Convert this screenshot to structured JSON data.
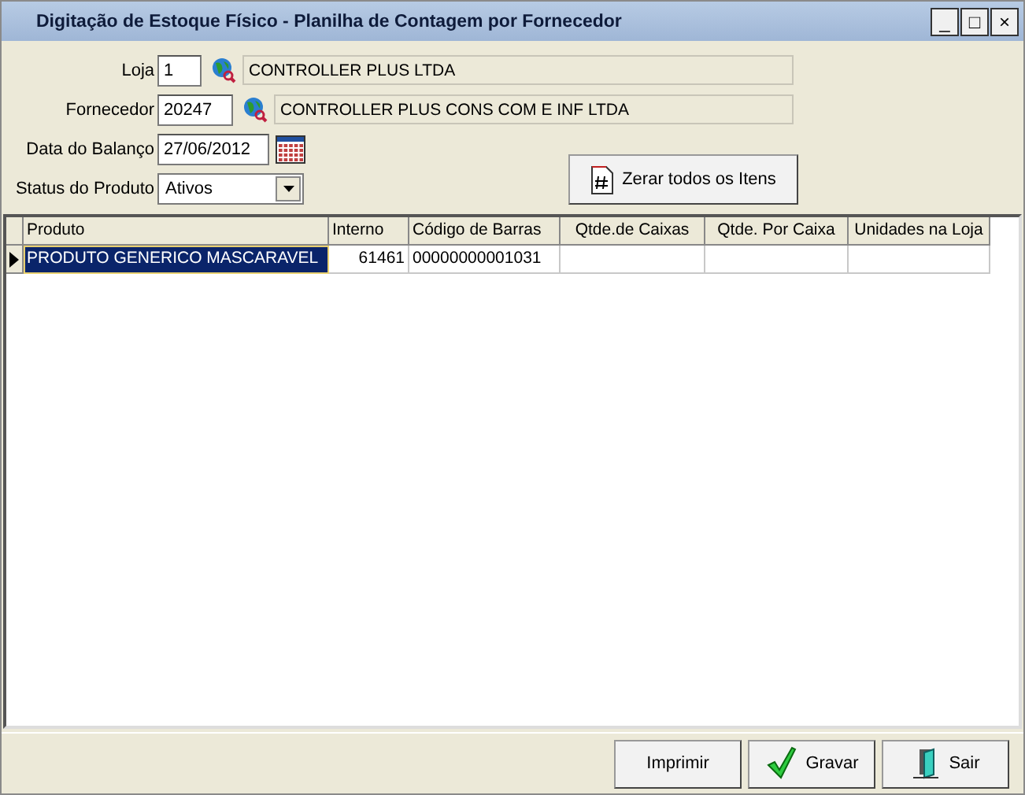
{
  "window": {
    "title": "Digitação de Estoque Físico - Planilha de Contagem por Fornecedor",
    "controls": [
      "_",
      "□",
      "×"
    ]
  },
  "form": {
    "loja": {
      "label": "Loja",
      "value": "1",
      "name": "CONTROLLER PLUS LTDA"
    },
    "fornecedor": {
      "label": "Fornecedor",
      "value": "20247",
      "name": "CONTROLLER PLUS CONS COM E INF LTDA"
    },
    "data": {
      "label": "Data do Balanço",
      "value": "27/06/2012"
    },
    "status": {
      "label": "Status do Produto",
      "value": "Ativos"
    },
    "zerar_button": "Zerar todos os Itens"
  },
  "table": {
    "columns": [
      "Produto",
      "Interno",
      "Código de Barras",
      "Qtde.de Caixas",
      "Qtde. Por Caixa",
      "Unidades na Loja"
    ],
    "rows": [
      {
        "selected": true,
        "cells": [
          "PRODUTO GENERICO MASCARAVEL",
          "61461",
          "00000000001031",
          "",
          "",
          ""
        ]
      }
    ]
  },
  "buttons": [
    {
      "kind": "print",
      "label": "Imprimir"
    },
    {
      "kind": "save",
      "label": "Gravar"
    },
    {
      "kind": "exit",
      "label": "Sair"
    }
  ]
}
